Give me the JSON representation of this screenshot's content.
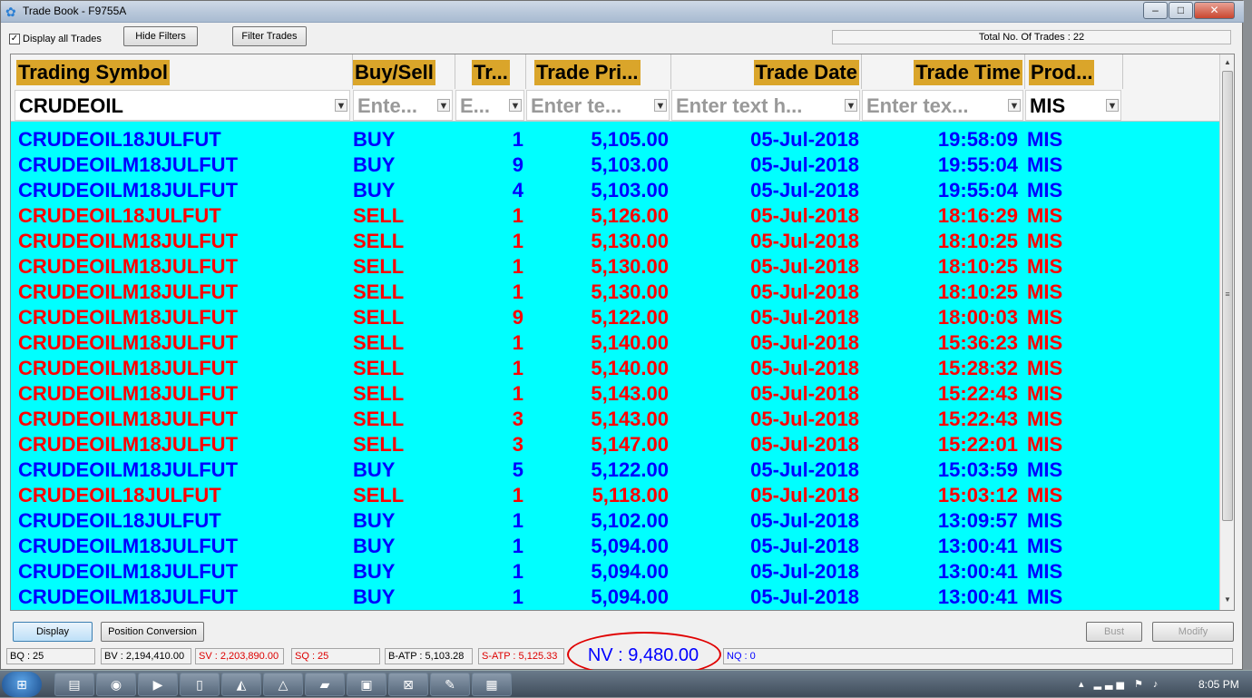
{
  "window": {
    "title": "Trade Book - F9755A"
  },
  "toolbar": {
    "display_all_label": "Display all Trades",
    "hide_filters_label": "Hide Filters",
    "filter_trades_label": "Filter Trades",
    "total_trades": "Total No. Of Trades : 22"
  },
  "columns": [
    "Trading Symbol",
    "Buy/Sell",
    "Tr...",
    "Trade Pri...",
    "Trade Date",
    "Trade Time",
    "Prod..."
  ],
  "filters": [
    "CRUDEOIL",
    "Ente...",
    "E...",
    "Enter te...",
    "Enter text h...",
    "Enter tex...",
    "MIS"
  ],
  "colors": {
    "buy": "#0000ff",
    "sell": "#ff0000",
    "header_bg": "#daa52a",
    "grid_bg": "#00ffff"
  },
  "trades": [
    {
      "symbol": "CRUDEOIL18JULFUT",
      "side": "BUY",
      "qty": "1",
      "price": "5,105.00",
      "date": "05-Jul-2018",
      "time": "19:58:09",
      "product": "MIS"
    },
    {
      "symbol": "CRUDEOILM18JULFUT",
      "side": "BUY",
      "qty": "9",
      "price": "5,103.00",
      "date": "05-Jul-2018",
      "time": "19:55:04",
      "product": "MIS"
    },
    {
      "symbol": "CRUDEOILM18JULFUT",
      "side": "BUY",
      "qty": "4",
      "price": "5,103.00",
      "date": "05-Jul-2018",
      "time": "19:55:04",
      "product": "MIS"
    },
    {
      "symbol": "CRUDEOIL18JULFUT",
      "side": "SELL",
      "qty": "1",
      "price": "5,126.00",
      "date": "05-Jul-2018",
      "time": "18:16:29",
      "product": "MIS"
    },
    {
      "symbol": "CRUDEOILM18JULFUT",
      "side": "SELL",
      "qty": "1",
      "price": "5,130.00",
      "date": "05-Jul-2018",
      "time": "18:10:25",
      "product": "MIS"
    },
    {
      "symbol": "CRUDEOILM18JULFUT",
      "side": "SELL",
      "qty": "1",
      "price": "5,130.00",
      "date": "05-Jul-2018",
      "time": "18:10:25",
      "product": "MIS"
    },
    {
      "symbol": "CRUDEOILM18JULFUT",
      "side": "SELL",
      "qty": "1",
      "price": "5,130.00",
      "date": "05-Jul-2018",
      "time": "18:10:25",
      "product": "MIS"
    },
    {
      "symbol": "CRUDEOILM18JULFUT",
      "side": "SELL",
      "qty": "9",
      "price": "5,122.00",
      "date": "05-Jul-2018",
      "time": "18:00:03",
      "product": "MIS"
    },
    {
      "symbol": "CRUDEOILM18JULFUT",
      "side": "SELL",
      "qty": "1",
      "price": "5,140.00",
      "date": "05-Jul-2018",
      "time": "15:36:23",
      "product": "MIS"
    },
    {
      "symbol": "CRUDEOILM18JULFUT",
      "side": "SELL",
      "qty": "1",
      "price": "5,140.00",
      "date": "05-Jul-2018",
      "time": "15:28:32",
      "product": "MIS"
    },
    {
      "symbol": "CRUDEOILM18JULFUT",
      "side": "SELL",
      "qty": "1",
      "price": "5,143.00",
      "date": "05-Jul-2018",
      "time": "15:22:43",
      "product": "MIS"
    },
    {
      "symbol": "CRUDEOILM18JULFUT",
      "side": "SELL",
      "qty": "3",
      "price": "5,143.00",
      "date": "05-Jul-2018",
      "time": "15:22:43",
      "product": "MIS"
    },
    {
      "symbol": "CRUDEOILM18JULFUT",
      "side": "SELL",
      "qty": "3",
      "price": "5,147.00",
      "date": "05-Jul-2018",
      "time": "15:22:01",
      "product": "MIS"
    },
    {
      "symbol": "CRUDEOILM18JULFUT",
      "side": "BUY",
      "qty": "5",
      "price": "5,122.00",
      "date": "05-Jul-2018",
      "time": "15:03:59",
      "product": "MIS"
    },
    {
      "symbol": "CRUDEOIL18JULFUT",
      "side": "SELL",
      "qty": "1",
      "price": "5,118.00",
      "date": "05-Jul-2018",
      "time": "15:03:12",
      "product": "MIS"
    },
    {
      "symbol": "CRUDEOIL18JULFUT",
      "side": "BUY",
      "qty": "1",
      "price": "5,102.00",
      "date": "05-Jul-2018",
      "time": "13:09:57",
      "product": "MIS"
    },
    {
      "symbol": "CRUDEOILM18JULFUT",
      "side": "BUY",
      "qty": "1",
      "price": "5,094.00",
      "date": "05-Jul-2018",
      "time": "13:00:41",
      "product": "MIS"
    },
    {
      "symbol": "CRUDEOILM18JULFUT",
      "side": "BUY",
      "qty": "1",
      "price": "5,094.00",
      "date": "05-Jul-2018",
      "time": "13:00:41",
      "product": "MIS"
    },
    {
      "symbol": "CRUDEOILM18JULFUT",
      "side": "BUY",
      "qty": "1",
      "price": "5,094.00",
      "date": "05-Jul-2018",
      "time": "13:00:41",
      "product": "MIS"
    }
  ],
  "buttons": {
    "display": "Display",
    "position_conversion": "Position Conversion",
    "bust": "Bust",
    "modify": "Modify"
  },
  "status": {
    "bq": "BQ : 25",
    "bv": "BV : 2,194,410.00",
    "sv": "SV : 2,203,890.00",
    "sq": "SQ : 25",
    "batp": "B-ATP : 5,103.28",
    "satp": "S-ATP : 5,125.33",
    "nv": "NV : 9,480.00",
    "nq": "NQ : 0"
  },
  "taskbar": {
    "clock": "8:05 PM"
  }
}
